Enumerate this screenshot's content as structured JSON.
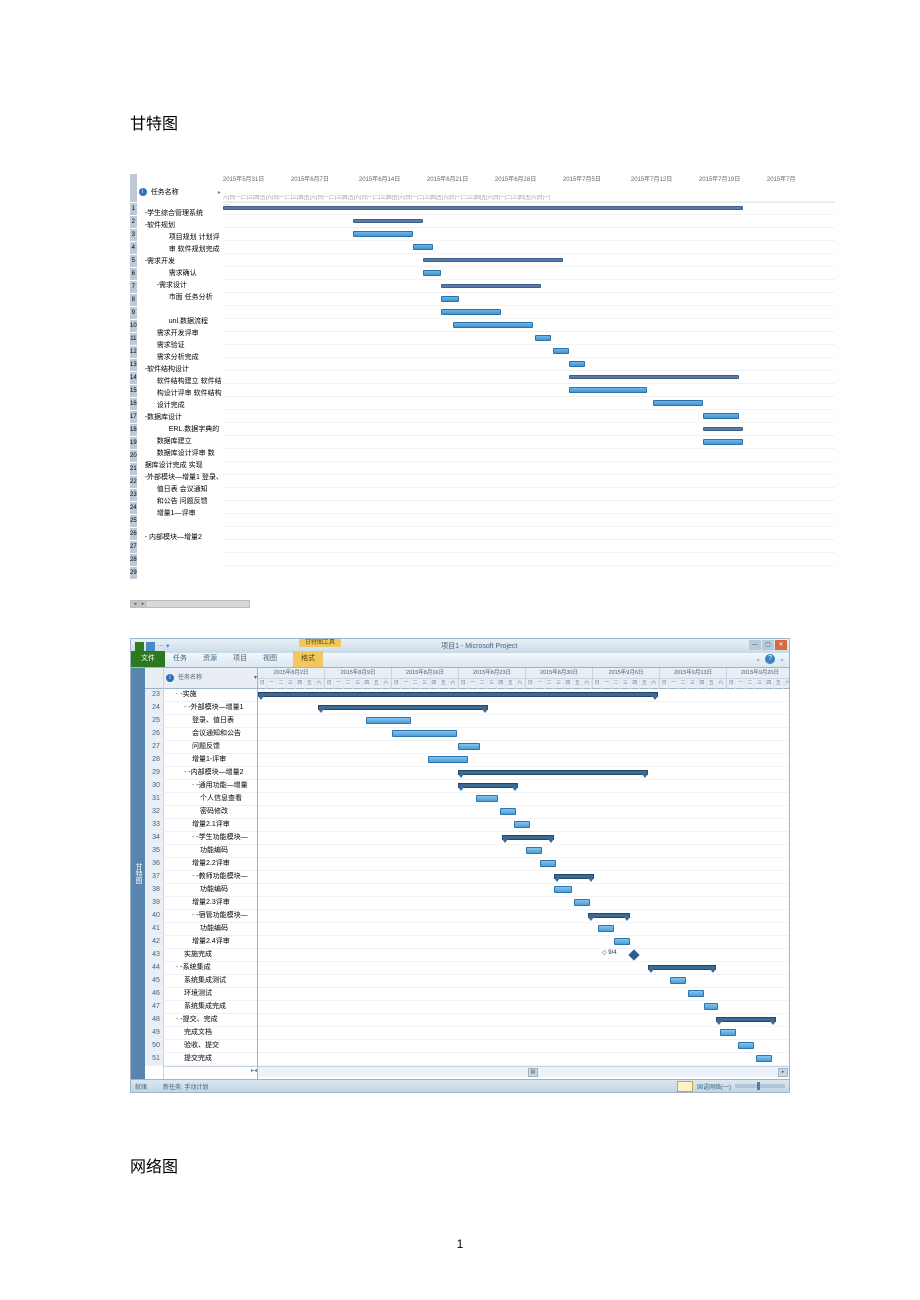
{
  "page": {
    "title_gantt": "甘特图",
    "title_network": "网络图",
    "page_number": "1"
  },
  "gantt1": {
    "columns": {
      "task_name": "任务名称"
    },
    "dates": [
      "2015年5月31日",
      "2015年6月7日",
      "2015年6月14日",
      "2015年6月21日",
      "2015年6月28日",
      "2015年7月5日",
      "2015年7月12日",
      "2015年7月19日",
      "2015年7月"
    ],
    "day_pattern_line1": "六|日|一|二|三|四|五|六|日|一|二|三|四|五|六|日|一|二|三|四|五|六|日|一|二|三|四|五|六|日|一|二|三|四|五|六|日|一|二|三|四|五|六|日|一|二|三|四|五|六|日|一|",
    "day_pattern_line2": "二|",
    "tasks": [
      {
        "id": "1",
        "name": "-学生综合管理系统",
        "indent": 0,
        "type": "summary",
        "start": 0,
        "len": 520
      },
      {
        "id": "2",
        "name": "-软件规划",
        "indent": 0,
        "type": "summary",
        "start": 130,
        "len": 70
      },
      {
        "id": "3",
        "name": "项目规划  计划评",
        "indent": 2,
        "type": "task",
        "start": 130,
        "len": 60
      },
      {
        "id": "4",
        "name": "审  软件规划完成",
        "indent": 2,
        "type": "task",
        "start": 190,
        "len": 20
      },
      {
        "id": "5",
        "name": "-需求开发",
        "indent": 0,
        "type": "summary",
        "start": 200,
        "len": 140
      },
      {
        "id": "6",
        "name": "需求确认",
        "indent": 2,
        "type": "task",
        "start": 200,
        "len": 18
      },
      {
        "id": "7",
        "name": "-需求设计",
        "indent": 1,
        "type": "summary",
        "start": 218,
        "len": 100
      },
      {
        "id": "8",
        "name": "市面 任务分析",
        "indent": 2,
        "type": "task",
        "start": 218,
        "len": 18
      },
      {
        "id": "9",
        "name": "",
        "indent": 2,
        "type": "task",
        "start": 218,
        "len": 60
      },
      {
        "id": "10",
        "name": "unl.数据流程",
        "indent": 2,
        "type": "task",
        "start": 230,
        "len": 80
      },
      {
        "id": "11",
        "name": "需求开发评审",
        "indent": 1,
        "type": "task",
        "start": 312,
        "len": 16
      },
      {
        "id": "12",
        "name": "需求验证",
        "indent": 1,
        "type": "task",
        "start": 330,
        "len": 16
      },
      {
        "id": "13",
        "name": "需求分析完成",
        "indent": 1,
        "type": "task",
        "start": 346,
        "len": 16
      },
      {
        "id": "14",
        "name": "-软件结构设计",
        "indent": 0,
        "type": "summary",
        "start": 346,
        "len": 170
      },
      {
        "id": "15",
        "name": "软件结构建立  软件结",
        "indent": 1,
        "type": "task",
        "start": 346,
        "len": 78
      },
      {
        "id": "16",
        "name": "构设计评审  软件结构",
        "indent": 1,
        "type": "task",
        "start": 430,
        "len": 50
      },
      {
        "id": "17",
        "name": "设计完成",
        "indent": 1,
        "type": "task",
        "start": 480,
        "len": 36
      },
      {
        "id": "18",
        "name": "-数据库设计",
        "indent": 0,
        "type": "summary",
        "start": 480,
        "len": 40
      },
      {
        "id": "19",
        "name": "ERL.数据字典的",
        "indent": 2,
        "type": "task",
        "start": 480,
        "len": 40
      },
      {
        "id": "20",
        "name": "数据库建立",
        "indent": 1,
        "type": "none"
      },
      {
        "id": "21",
        "name": "数据库设计评审  数",
        "indent": 1,
        "type": "none"
      },
      {
        "id": "22",
        "name": "据库设计完成 实现",
        "indent": 0,
        "type": "none"
      },
      {
        "id": "23",
        "name": "-外部模块—增量1 登录、",
        "indent": 0,
        "type": "none"
      },
      {
        "id": "24",
        "name": "值日表  会议通知",
        "indent": 1,
        "type": "none"
      },
      {
        "id": "25",
        "name": "和公告  问题反馈",
        "indent": 1,
        "type": "none"
      },
      {
        "id": "26",
        "name": "增量1—评审",
        "indent": 1,
        "type": "none"
      },
      {
        "id": "27",
        "name": "",
        "indent": 1,
        "type": "none"
      },
      {
        "id": "28",
        "name": "- 内部模块—增量2",
        "indent": 0,
        "type": "none"
      },
      {
        "id": "29",
        "name": "",
        "indent": 0,
        "type": "none"
      }
    ]
  },
  "gantt2": {
    "window": {
      "title_center": "项目1 - Microsoft Project",
      "context_title": "甘特图工具"
    },
    "ribbon": {
      "file": "文件",
      "tabs": [
        "任务",
        "资源",
        "项目",
        "视图"
      ],
      "active": "格式"
    },
    "columns": {
      "task_name": "任务名称"
    },
    "dates": [
      "2015年8月2日",
      "2015年8月9日",
      "2015年8月16日",
      "2015年8月23日",
      "2015年8月30日",
      "2015年9月6日",
      "2015年9月13日",
      "2015年9月20日",
      "201"
    ],
    "days": [
      "日",
      "一",
      "二",
      "三",
      "四",
      "五",
      "六"
    ],
    "tasks": [
      {
        "id": "23",
        "name": "-实施",
        "indent": 1,
        "type": "summary",
        "start": 0,
        "len": 400,
        "collapse": "-"
      },
      {
        "id": "24",
        "name": "-外部模块—增量1",
        "indent": 2,
        "type": "summary",
        "start": 60,
        "len": 170,
        "collapse": "-"
      },
      {
        "id": "25",
        "name": "登录、值日表",
        "indent": 3,
        "type": "task",
        "start": 108,
        "len": 45
      },
      {
        "id": "26",
        "name": "会议通知和公告",
        "indent": 3,
        "type": "task",
        "start": 134,
        "len": 65
      },
      {
        "id": "27",
        "name": "问题反馈",
        "indent": 3,
        "type": "task",
        "start": 200,
        "len": 22
      },
      {
        "id": "28",
        "name": "增量1-评审",
        "indent": 3,
        "type": "task",
        "start": 170,
        "len": 40
      },
      {
        "id": "29",
        "name": "-内部模块—增量2",
        "indent": 2,
        "type": "summary",
        "start": 200,
        "len": 190,
        "collapse": "-"
      },
      {
        "id": "30",
        "name": "-通用功能—增量",
        "indent": 3,
        "type": "summary",
        "start": 200,
        "len": 60,
        "collapse": "-"
      },
      {
        "id": "31",
        "name": "个人信息查看",
        "indent": 4,
        "type": "task",
        "start": 218,
        "len": 22
      },
      {
        "id": "32",
        "name": "密码修改",
        "indent": 4,
        "type": "task",
        "start": 242,
        "len": 16
      },
      {
        "id": "33",
        "name": "增量2.1评审",
        "indent": 3,
        "type": "task",
        "start": 256,
        "len": 16
      },
      {
        "id": "34",
        "name": "-学生功能模块—",
        "indent": 3,
        "type": "summary",
        "start": 244,
        "len": 52,
        "collapse": "-"
      },
      {
        "id": "35",
        "name": "功能编码",
        "indent": 4,
        "type": "task",
        "start": 268,
        "len": 16
      },
      {
        "id": "36",
        "name": "增量2.2评审",
        "indent": 3,
        "type": "task",
        "start": 282,
        "len": 16
      },
      {
        "id": "37",
        "name": "-教师功能模块—",
        "indent": 3,
        "type": "summary",
        "start": 296,
        "len": 40,
        "collapse": "-"
      },
      {
        "id": "38",
        "name": "功能编码",
        "indent": 4,
        "type": "task",
        "start": 296,
        "len": 18
      },
      {
        "id": "39",
        "name": "增量2.3评审",
        "indent": 3,
        "type": "task",
        "start": 316,
        "len": 16
      },
      {
        "id": "40",
        "name": "-宿管功能模块—",
        "indent": 3,
        "type": "summary",
        "start": 330,
        "len": 42,
        "collapse": "-"
      },
      {
        "id": "41",
        "name": "功能编码",
        "indent": 4,
        "type": "task",
        "start": 340,
        "len": 16
      },
      {
        "id": "42",
        "name": "增量2.4评审",
        "indent": 3,
        "type": "task",
        "start": 356,
        "len": 16
      },
      {
        "id": "43",
        "name": "实施完成",
        "indent": 2,
        "type": "milestone",
        "start": 372,
        "label": "◇ 9/4"
      },
      {
        "id": "44",
        "name": "-系统集成",
        "indent": 1,
        "type": "summary",
        "start": 390,
        "len": 68,
        "collapse": "-"
      },
      {
        "id": "45",
        "name": "系统集成测试",
        "indent": 2,
        "type": "task",
        "start": 412,
        "len": 16
      },
      {
        "id": "46",
        "name": "环境测试",
        "indent": 2,
        "type": "task",
        "start": 430,
        "len": 16
      },
      {
        "id": "47",
        "name": "系统集成完成",
        "indent": 2,
        "type": "task",
        "start": 446,
        "len": 14
      },
      {
        "id": "48",
        "name": "-提交、完成",
        "indent": 1,
        "type": "summary",
        "start": 458,
        "len": 60,
        "collapse": "-"
      },
      {
        "id": "49",
        "name": "完成文档",
        "indent": 2,
        "type": "task",
        "start": 462,
        "len": 16
      },
      {
        "id": "50",
        "name": "验收、提交",
        "indent": 2,
        "type": "task",
        "start": 480,
        "len": 16
      },
      {
        "id": "51",
        "name": "提交完成",
        "indent": 2,
        "type": "task",
        "start": 498,
        "len": 16
      }
    ],
    "status": {
      "left": "就绪",
      "new_tasks": "新任务: 手动计划",
      "right": "国语网络(一)"
    },
    "side_strip": "甘特图"
  }
}
